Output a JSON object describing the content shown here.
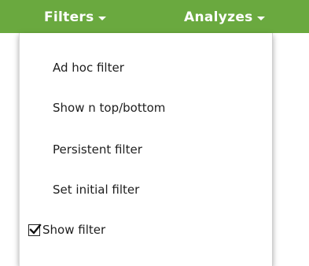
{
  "menubar": {
    "tabs": [
      {
        "label": "Filters"
      },
      {
        "label": "Analyzes"
      }
    ],
    "background_color": "#6aa93f"
  },
  "dropdown": {
    "items": [
      {
        "label": "Ad hoc filter"
      },
      {
        "label": "Show n top/bottom"
      },
      {
        "label": "Persistent filter"
      },
      {
        "label": "Set initial filter"
      },
      {
        "label": "Show filter",
        "checked": true,
        "icon": "checkbox-checked-icon"
      }
    ]
  }
}
